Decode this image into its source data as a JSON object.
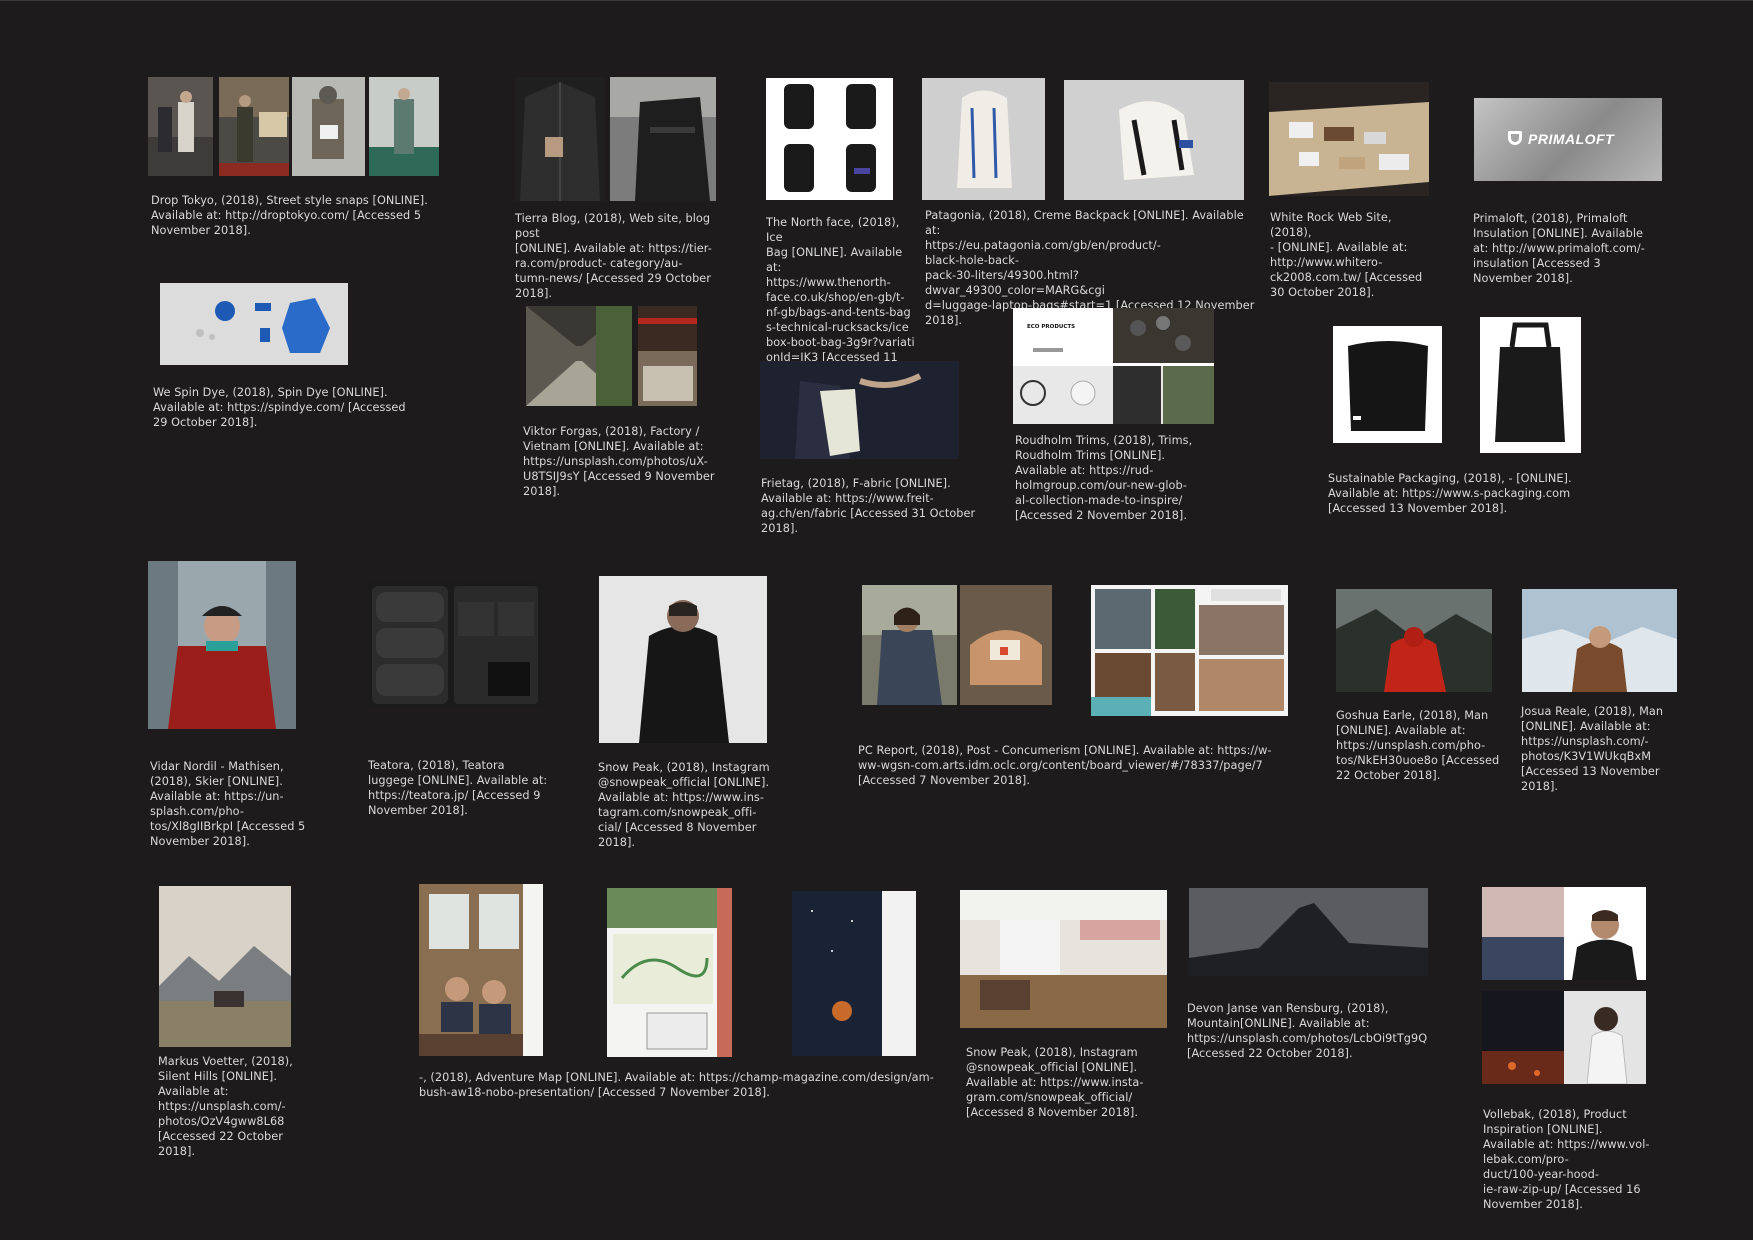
{
  "captions": {
    "drop_tokyo": "Drop Tokyo, (2018), Street style snaps [ONLINE].\nAvailable at: http://droptokyo.com/ [Accessed 5\nNovember 2018].",
    "tierra": "Tierra Blog, (2018), Web site, blog post\n[ONLINE]. Available at: https://tier-\nra.com/product- category/au-\ntumn-news/ [Accessed 29 October\n2018].",
    "north_face": "The North face, (2018), Ice\nBag [ONLINE]. Available at:\nhttps://www.thenorth-\nface.co.uk/shop/en-gb/t-\nnf-gb/bags-and-tents-bag\ns-technical-rucksacks/ice\nbox-boot-bag-3g9r?variati\nonId=JK3 [Accessed 11\nNovember 2018].",
    "patagonia": "Patagonia, (2018), Creme Backpack [ONLINE]. Available at:\nhttps://eu.patagonia.com/gb/en/product/-\nblack-hole-back-\npack-30-liters/49300.html?dwvar_49300_color=MARG&cgi\nd=luggage-laptop-bags#start=1 [Accessed 12 November\n2018].",
    "white_rock": "White Rock Web Site, (2018),\n- [ONLINE]. Available at:\nhttp://www.whitero-\nck2008.com.tw/ [Accessed\n30 October 2018].",
    "primaloft": "Primaloft, (2018), Primaloft\nInsulation [ONLINE]. Available\nat: http://www.primaloft.com/-\ninsulation [Accessed 3\nNovember 2018].",
    "spin_dye": "We Spin Dye, (2018), Spin Dye [ONLINE].\nAvailable at: https://spindye.com/ [Accessed\n29 October 2018].",
    "viktor": "Viktor Forgas, (2018), Factory /\nVietnam [ONLINE]. Available at:\nhttps://unsplash.com/photos/uX-\nU8TSIJ9sY [Accessed 9 November\n2018].",
    "frietag": "Frietag, (2018), F-abric [ONLINE].\nAvailable at: https://www.freit-\nag.ch/en/fabric [Accessed 31 October\n2018].",
    "roudholm": "Roudholm Trims, (2018), Trims,\nRoudholm Trims [ONLINE].\nAvailable at: https://rud-\nholmgroup.com/our-new-glob-\nal-collection-made-to-inspire/\n[Accessed 2 November 2018].",
    "sustainable": "Sustainable Packaging, (2018), - [ONLINE].\nAvailable at: https://www.s-packaging.com\n[Accessed 13 November 2018].",
    "vidar": "Vidar Nordil - Mathisen,\n(2018), Skier [ONLINE].\nAvailable at: https://un-\nsplash.com/pho-\ntos/Xl8gIIBrkpI [Accessed 5\nNovember 2018].",
    "teatora": "Teatora, (2018), Teatora\nluggege [ONLINE]. Available at:\nhttps://teatora.jp/ [Accessed 9\nNovember 2018].",
    "snowpeak1": "Snow Peak, (2018), Instagram\n@snowpeak_official [ONLINE].\nAvailable at: https://www.ins-\ntagram.com/snowpeak_offi-\ncial/ [Accessed 8 November\n2018].",
    "pc_report": "PC Report, (2018), Post - Concumerism [ONLINE]. Available at: https://w-\nww-wgsn-com.arts.idm.oclc.org/content/board_viewer/#/78337/page/7\n[Accessed 7 November 2018].",
    "goshua": "Goshua Earle, (2018), Man\n[ONLINE]. Available at:\nhttps://unsplash.com/pho-\ntos/NkEH30uoe8o [Accessed\n22 October 2018].",
    "josua": "Josua Reale, (2018), Man\n[ONLINE]. Available at:\nhttps://unsplash.com/-\nphotos/K3V1WUkqBxM\n[Accessed 13 November\n2018].",
    "markus": "Markus Voetter, (2018),\nSilent Hills [ONLINE].\nAvailable at:\nhttps://unsplash.com/-\nphotos/OzV4gww8L68\n[Accessed 22 October\n2018].",
    "adventure_map": "-, (2018), Adventure Map [ONLINE]. Available at: https://champ-magazine.com/design/am-\nbush-aw18-nobo-presentation/ [Accessed 7 November 2018].",
    "snowpeak2": "Snow Peak, (2018), Instagram\n@snowpeak_official [ONLINE].\nAvailable at: https://www.insta-\ngram.com/snowpeak_official/\n[Accessed 8 November 2018].",
    "devon": "Devon Janse van Rensburg, (2018),\nMountain[ONLINE]. Available at:\nhttps://unsplash.com/photos/LcbOi9tTg9Q\n[Accessed 22 October 2018].",
    "vollebak": "Vollebak, (2018), Product\nInspiration [ONLINE].\nAvailable at: https://www.vol-\nlebak.com/pro-\nduct/100-year-hood-\nie-raw-zip-up/ [Accessed 16\nNovember 2018]."
  },
  "logos": {
    "primaloft": "PRIMALOFT",
    "eco_products": "ECO PRODUCTS"
  }
}
